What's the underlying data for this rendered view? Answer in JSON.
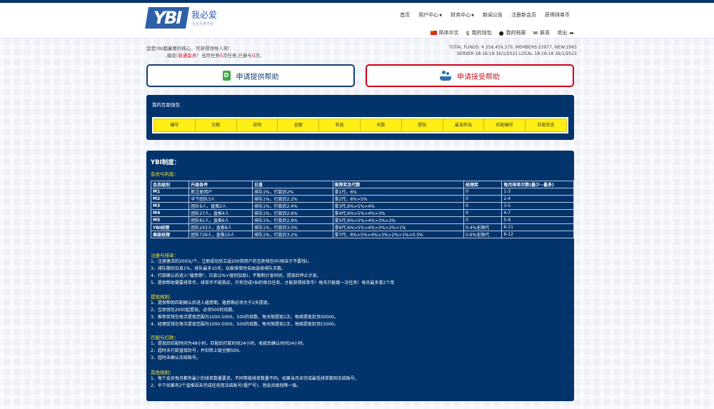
{
  "brand": {
    "mark": "YBI",
    "name_cn": "我必爱",
    "tagline": "互信互惠平台"
  },
  "nav": {
    "home": "首页",
    "user_center": "用户中心",
    "finance_center": "财务中心",
    "news": "新闻公告",
    "register": "注册新会员",
    "buy_coin": "获得排单币"
  },
  "subnav": {
    "language": "简体中文",
    "wallet": "我的钱包",
    "profile": "我的档案",
    "contact": "联系",
    "logout": "退出"
  },
  "status": {
    "line1": "您是YBI圆童要的核心，可获得领导人奖!",
    "line2_a": ",级别:",
    "level": "普通会员",
    "line2_b": "！当月任务",
    "task_count": "0",
    "line2_c": "次任务,已参与",
    "joined": "0",
    "line2_d": "次。"
  },
  "stats": {
    "line1": "TOTAL FUNDS: ¥ 258,459,379, MEMBERS:53977, NEW:2965",
    "line2": "SERVER   18:16:18 16/1/2021  LOCAL   18:16:18 16/1/2021"
  },
  "actions": {
    "provide": "申请提供帮助",
    "accept": "申请接受帮助"
  },
  "wallet": {
    "title": "我的互助钱包",
    "columns": [
      "编号",
      "日期",
      "说明",
      "金额",
      "利息",
      "天数",
      "提现",
      "最苦终出",
      "匹配编号",
      "匹配状态"
    ]
  },
  "rules": {
    "title": "YBI制度：",
    "member_head": "会员与利息：",
    "table_headers": [
      "会员级别",
      "升级条件",
      "日息",
      "推荐奖及代数",
      "经理奖",
      "每月排单次数(最少~最多)"
    ],
    "table_rows": [
      [
        "M1",
        "新注册用户",
        "排队1%，打款后2%",
        "拿1代，6%",
        "0",
        "1-3"
      ],
      [
        "M2",
        "伞下团队3人",
        "排队1%，打款后2.2%",
        "拿2代，6%>5%",
        "0",
        "2-4"
      ],
      [
        "M3",
        "团队9人，直推2人",
        "排队1%，打款后2.4%",
        "拿3代,6%>5%>4%",
        "0",
        "3-5"
      ],
      [
        "M4",
        "团队27人，直推4人",
        "排队1%，打款后2.6%",
        "拿4代,6%>5%>4%>3%",
        "0",
        "4-7"
      ],
      [
        "M5",
        "团队81人，直推6人",
        "排队1%，打款后2.8%",
        "拿5代,6%>5%>4%>3%>2%",
        "0",
        "5-9"
      ],
      [
        "YBI经理",
        "团队243人，直推8人",
        "排队1%，打款后3.0%",
        "拿6代,6%>5%>4%>3%>2%>1%",
        "0.4%无限代",
        "6-11"
      ],
      [
        "高级经理",
        "团队729人，直推10人",
        "排队1%，打款后3.2%",
        "拿7代，6%>5%>4%>3%>2%>1%>0.5%",
        "0.6%无限代",
        "6-12"
      ]
    ],
    "register_head": "注册与排单：",
    "register_items": [
      "1、注册激活的200元/个，注册成功后立返200到用户的互助钱包中(相当于不要钱)。",
      "3、排队期间日息1%，排队最多10天，玩家排单时自由选择排队天数。",
      "4、打款确认后进入\"蕴意期\"，日息(2%+级别加息)，不限制计息时间，提现后停止计息。",
      "5、提供帮助需要排单币，排单币不能购买，只有完成YBI的每日任务，才能获得排单币！每天只能做一次任务！每天最多拿2个单"
    ],
    "withdraw_head": "提现规则：",
    "withdraw_items": [
      "1、提供帮助匹配确认后进入蕴意期，蕴意期必须大于2天提现。",
      "2、互助钱包2000起提现，必须500的倍数。",
      "3、推荐奖钱包每次提现范围为1000-5000，500的倍数，每天限提现1次，每周提现封顶30000。",
      "4、经理奖钱包每次提现范围为1000-5000，500的倍数，每天限提现1次，每周提现封顶15000。"
    ],
    "match_head": "匹配与打款：",
    "match_items": [
      "1、提现后匹配时间为48小时，匹配后打款时间24小时，收款后确认时间24小时。",
      "2、超时未打款直接封号，并扣除上级全额500。",
      "3、超时未确认冻结账号。"
    ],
    "other_head": "其他规则：",
    "other_items": [
      "1、每个会员每月都有最少的排单数量要求，不同等级排单数量不同。如果当月未完成最低排单数则冻结账号。",
      "2、伞下如果有2个直推因未完成任务而冻结账号(僵尸号)，则会员级别降一级。"
    ]
  },
  "colors": {
    "navy": "#02336b",
    "accent_red": "#d0021b",
    "yellow_header": "#ffef14",
    "rule_heading": "#f5e52a"
  }
}
